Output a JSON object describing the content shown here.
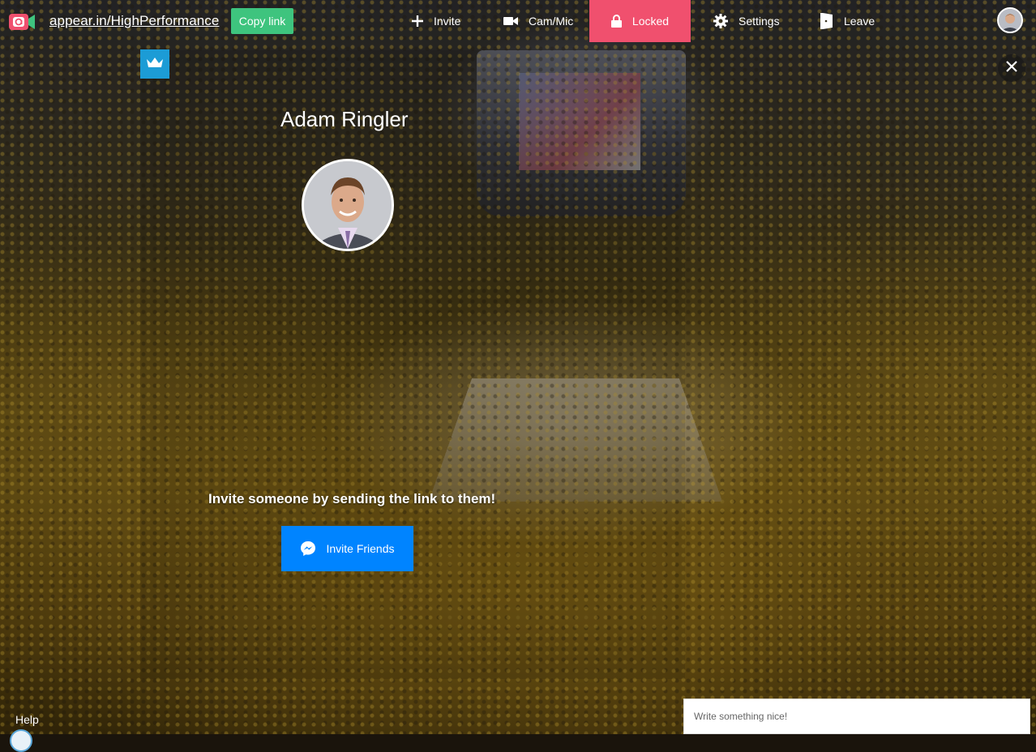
{
  "topbar": {
    "room_link": "appear.in/HighPerformance",
    "copy_link_label": "Copy link",
    "nav": {
      "invite": "Invite",
      "cam_mic": "Cam/Mic",
      "locked": "Locked",
      "settings": "Settings",
      "leave": "Leave"
    },
    "locked_color": "#f0506e",
    "copy_color": "#3ec47e"
  },
  "participant": {
    "name": "Adam Ringler",
    "badge_icon": "crown-icon"
  },
  "invite": {
    "message": "Invite someone by sending the link to them!",
    "button_label": "Invite Friends",
    "button_color": "#0084ff"
  },
  "footer": {
    "help_label": "Help"
  },
  "chat": {
    "placeholder": "Write something nice!"
  }
}
